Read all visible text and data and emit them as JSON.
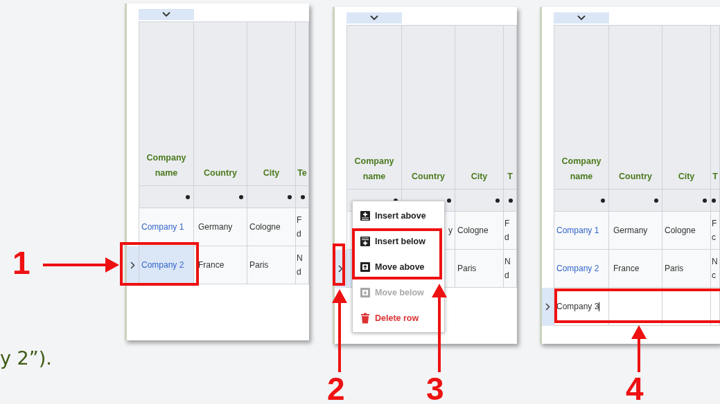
{
  "caption_fragment": "y 2”).",
  "panels": [
    {
      "columns": [
        {
          "label": "Company name",
          "kind": "link"
        },
        {
          "label": "Country",
          "kind": "text"
        },
        {
          "label": "City",
          "kind": "text"
        },
        {
          "label": "Te",
          "kind": "text"
        }
      ],
      "rows": [
        {
          "cells": [
            "Company 1",
            "Germany",
            "Cologne",
            "F d"
          ],
          "selected": false,
          "editing": false
        },
        {
          "cells": [
            "Company 2",
            "France",
            "Paris",
            "N d"
          ],
          "selected": true,
          "editing": false
        }
      ]
    },
    {
      "columns": [
        {
          "label": "Company name"
        },
        {
          "label": "Country"
        },
        {
          "label": "City"
        },
        {
          "label": "T"
        }
      ],
      "rows": [
        {
          "cells": [
            null,
            "y",
            "Cologne",
            "F d"
          ],
          "selected": false
        },
        {
          "cells": [
            null,
            null,
            "Paris",
            "N d"
          ],
          "selected": true
        }
      ],
      "menu": [
        {
          "label": "Insert above",
          "kind": "insert-above",
          "disabled": false
        },
        {
          "label": "Insert below",
          "kind": "insert-below",
          "disabled": false
        },
        {
          "label": "Move above",
          "kind": "move-above",
          "disabled": false
        },
        {
          "label": "Move below",
          "kind": "move-below",
          "disabled": true
        },
        {
          "label": "Delete row",
          "kind": "delete",
          "disabled": false
        }
      ]
    },
    {
      "columns": [
        {
          "label": "Company name",
          "kind": "link"
        },
        {
          "label": "Country",
          "kind": "text"
        },
        {
          "label": "City",
          "kind": "text"
        },
        {
          "label": "T",
          "kind": "text"
        }
      ],
      "rows": [
        {
          "cells": [
            "Company 1",
            "Germany",
            "Cologne",
            "F c"
          ],
          "selected": false,
          "editing": false
        },
        {
          "cells": [
            "Company 2",
            "France",
            "Paris",
            "N c"
          ],
          "selected": false,
          "editing": false
        },
        {
          "cells": [
            "Company 3",
            null,
            null,
            null
          ],
          "selected": true,
          "editing": true
        }
      ]
    }
  ],
  "annotations": [
    {
      "number": "1"
    },
    {
      "number": "2"
    },
    {
      "number": "3"
    },
    {
      "number": "4"
    }
  ]
}
